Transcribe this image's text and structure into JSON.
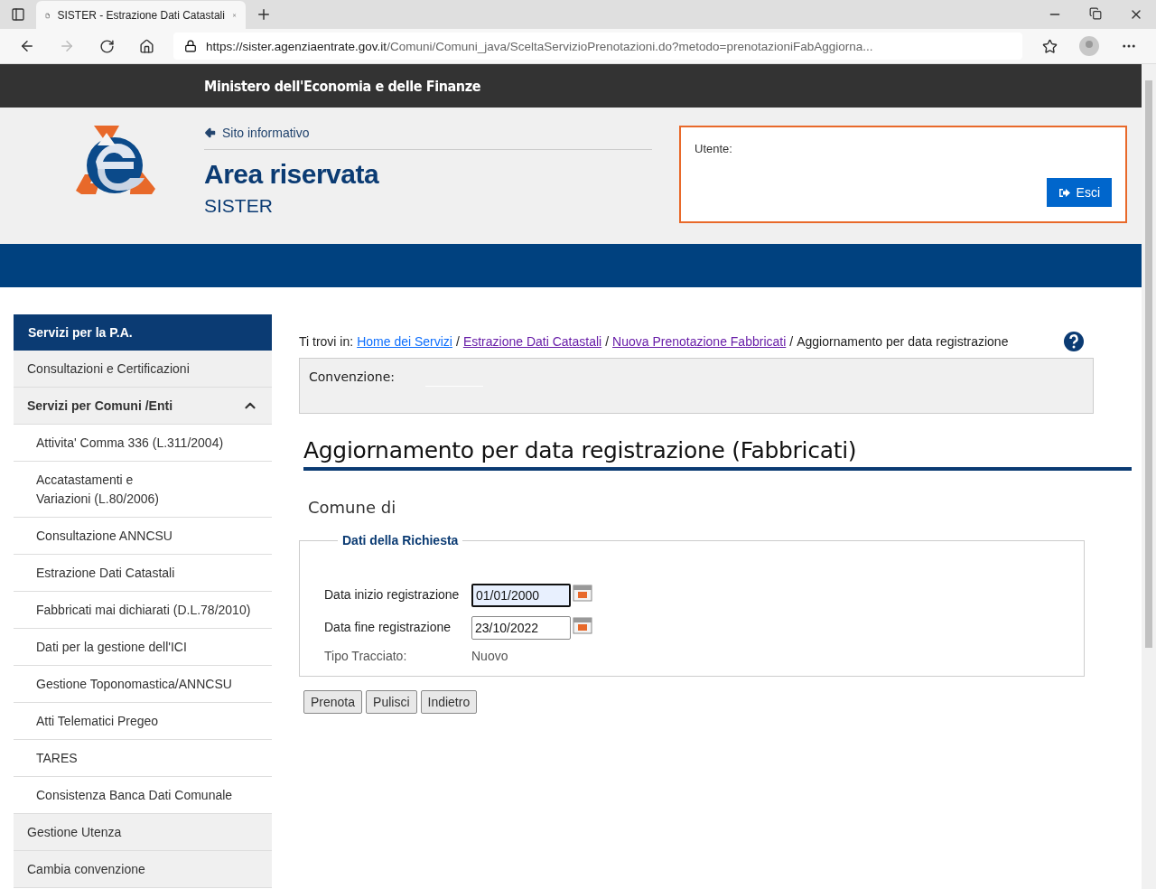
{
  "browser": {
    "tab_title": "SISTER - Estrazione Dati Catastali",
    "url_host": "https://sister.agenziaentrate.gov.it",
    "url_path": "/Comuni/Comuni_java/SceltaServizioPrenotazioni.do?metodo=prenotazioniFabAggiorna..."
  },
  "header": {
    "ministry": "Ministero dell'Economia e delle Finanze",
    "back_link": "Sito informativo",
    "title": "Area riservata",
    "subtitle": "SISTER",
    "user_label": "Utente:",
    "logout_button": "Esci"
  },
  "sidebar": {
    "heading": "Servizi per la P.A.",
    "items": [
      {
        "label": "Consultazioni e Certificazioni",
        "expanded": false
      },
      {
        "label": "Servizi per Comuni /Enti",
        "expanded": true,
        "children": [
          {
            "label": "Attivita' Comma 336 (L.311/2004)"
          },
          {
            "label": "Accatastamenti e Variazioni (L.80/2006)"
          },
          {
            "label": "Consultazione ANNCSU"
          },
          {
            "label": "Estrazione Dati Catastali"
          },
          {
            "label": "Fabbricati mai dichiarati (D.L.78/2010)"
          },
          {
            "label": "Dati per la gestione dell'ICI"
          },
          {
            "label": "Gestione Toponomastica/ANNCSU"
          },
          {
            "label": "Atti Telematici Pregeo"
          },
          {
            "label": "TARES"
          },
          {
            "label": "Consistenza Banca Dati Comunale"
          }
        ]
      },
      {
        "label": "Gestione Utenza",
        "expanded": false
      },
      {
        "label": "Cambia convenzione",
        "expanded": false
      }
    ]
  },
  "breadcrumb": {
    "prefix": "Ti trovi in:",
    "links": [
      {
        "label": "Home dei Servizi",
        "visited": false,
        "separator": "/"
      },
      {
        "label": "Estrazione Dati Catastali",
        "visited": true,
        "separator": "/"
      },
      {
        "label": "Nuova Prenotazione Fabbricati",
        "visited": true,
        "separator": "/"
      }
    ],
    "current": "Aggiornamento per data registrazione"
  },
  "convenzione_label": "Convenzione:",
  "page_title": "Aggiornamento per data registrazione (Fabbricati)",
  "comune_label": "Comune di",
  "form": {
    "legend": "Dati della Richiesta",
    "fields": [
      {
        "kind": "date",
        "label": "Data inizio registrazione",
        "value": "01/01/2000",
        "focused": true
      },
      {
        "kind": "date",
        "label": "Data fine registrazione",
        "value": "23/10/2022",
        "focused": false
      },
      {
        "kind": "text",
        "label": "Tipo Tracciato:",
        "value": "Nuovo"
      }
    ]
  },
  "buttons": [
    "Prenota",
    "Pulisci",
    "Indietro"
  ]
}
